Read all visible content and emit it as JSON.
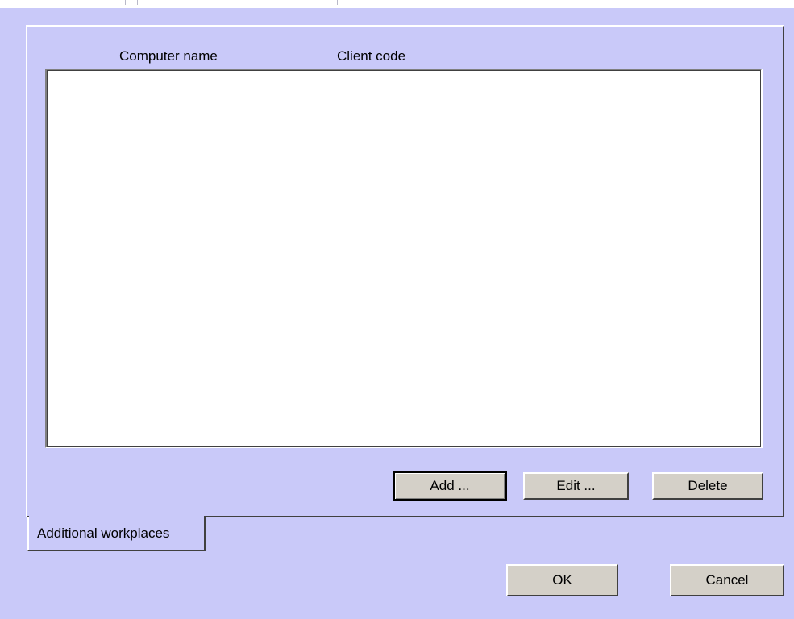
{
  "list": {
    "columns": [
      "Computer name",
      "Client code"
    ],
    "rows": []
  },
  "list_buttons": {
    "add": "Add ...",
    "edit": "Edit ...",
    "delete": "Delete"
  },
  "tabs": [
    {
      "label": "Additional workplaces",
      "selected": true
    }
  ],
  "dialog_buttons": {
    "ok": "OK",
    "cancel": "Cancel"
  },
  "colors": {
    "background": "#c9c9f9",
    "button_face": "#d4d0c8",
    "list_background": "#ffffff"
  }
}
